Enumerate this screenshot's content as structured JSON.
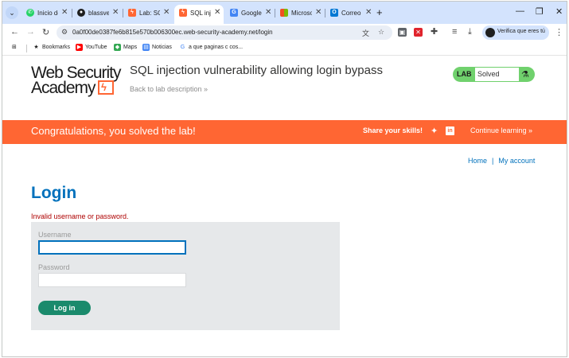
{
  "browser": {
    "tabs": [
      {
        "label": "Inicio de",
        "icon": "whatsapp-icon",
        "icon_color": "#25d366"
      },
      {
        "label": "blassve",
        "icon": "github-icon",
        "icon_color": "#1f1f1f"
      },
      {
        "label": "Lab: SQ",
        "icon": "portswigger-icon",
        "icon_color": "#ff6633"
      },
      {
        "label": "SQL inje",
        "icon": "portswigger-icon",
        "icon_color": "#ff6633",
        "active": true
      },
      {
        "label": "Google",
        "icon": "google-translate-icon",
        "icon_color": "#4285f4"
      },
      {
        "label": "Microso",
        "icon": "microsoft-icon",
        "icon_color": "#f25022"
      },
      {
        "label": "Correo",
        "icon": "outlook-icon",
        "icon_color": "#0078d4"
      }
    ],
    "new_tab_symbol": "+",
    "url": "0a0f00de0387fe6b815e570b006300ec.web-security-academy.net/login",
    "profile_label": "Verifica que eres tú",
    "bookmarks": [
      {
        "label": "Bookmarks",
        "icon": "star-icon",
        "icon_color": "#1f1f1f"
      },
      {
        "label": "YouTube",
        "icon": "youtube-icon",
        "icon_color": "#ff0000"
      },
      {
        "label": "Maps",
        "icon": "maps-icon",
        "icon_color": "#34a853"
      },
      {
        "label": "Noticias",
        "icon": "news-icon",
        "icon_color": "#4285f4"
      },
      {
        "label": "a que paginas c cos...",
        "icon": "google-icon",
        "icon_color": "#4285f4"
      }
    ]
  },
  "header": {
    "logo_line1": "Web Security",
    "logo_line2": "Academy",
    "title": "SQL injection vulnerability allowing login bypass",
    "back_link": "Back to lab description »",
    "lab_label": "LAB",
    "lab_status": "Solved"
  },
  "banner": {
    "message": "Congratulations, you solved the lab!",
    "share": "Share your skills!",
    "continue": "Continue learning »"
  },
  "nav": {
    "home": "Home",
    "separator": "|",
    "account": "My account"
  },
  "login": {
    "heading": "Login",
    "error": "Invalid username or password.",
    "username_label": "Username",
    "username_value": "",
    "password_label": "Password",
    "password_value": "",
    "button": "Log in"
  },
  "colors": {
    "accent_orange": "#ff6633",
    "link_blue": "#0071bc",
    "solved_green": "#70d16d",
    "button_green": "#1a8a6c",
    "error_red": "#ae0000"
  }
}
